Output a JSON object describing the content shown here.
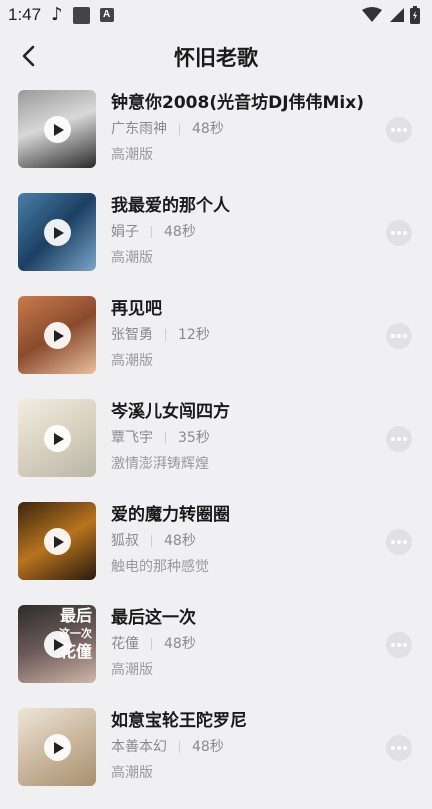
{
  "status_bar": {
    "time": "1:47",
    "icons": [
      "music-note-icon",
      "square-icon",
      "a-icon"
    ],
    "right_icons": [
      "wifi-icon",
      "signal-icon",
      "battery-icon"
    ]
  },
  "header": {
    "title": "怀旧老歌",
    "back_icon": "chevron-left-icon"
  },
  "songs": [
    {
      "title": "钟意你2008(光音坊DJ伟伟Mix)",
      "artist": "广东雨神",
      "duration": "48秒",
      "tag": "高潮版"
    },
    {
      "title": "我最爱的那个人",
      "artist": "娟子",
      "duration": "48秒",
      "tag": "高潮版"
    },
    {
      "title": "再见吧",
      "artist": "张智勇",
      "duration": "12秒",
      "tag": "高潮版"
    },
    {
      "title": "岑溪儿女闯四方",
      "artist": "覃飞宇",
      "duration": "35秒",
      "tag": "激情澎湃铸辉煌"
    },
    {
      "title": "爱的魔力转圈圈",
      "artist": "狐叔",
      "duration": "48秒",
      "tag": "触电的那种感觉"
    },
    {
      "title": "最后这一次",
      "artist": "花僮",
      "duration": "48秒",
      "tag": "高潮版",
      "cover_text": [
        "最后",
        "这一次",
        "花僮"
      ]
    },
    {
      "title": "如意宝轮王陀罗尼",
      "artist": "本善本幻",
      "duration": "48秒",
      "tag": "高潮版"
    }
  ]
}
